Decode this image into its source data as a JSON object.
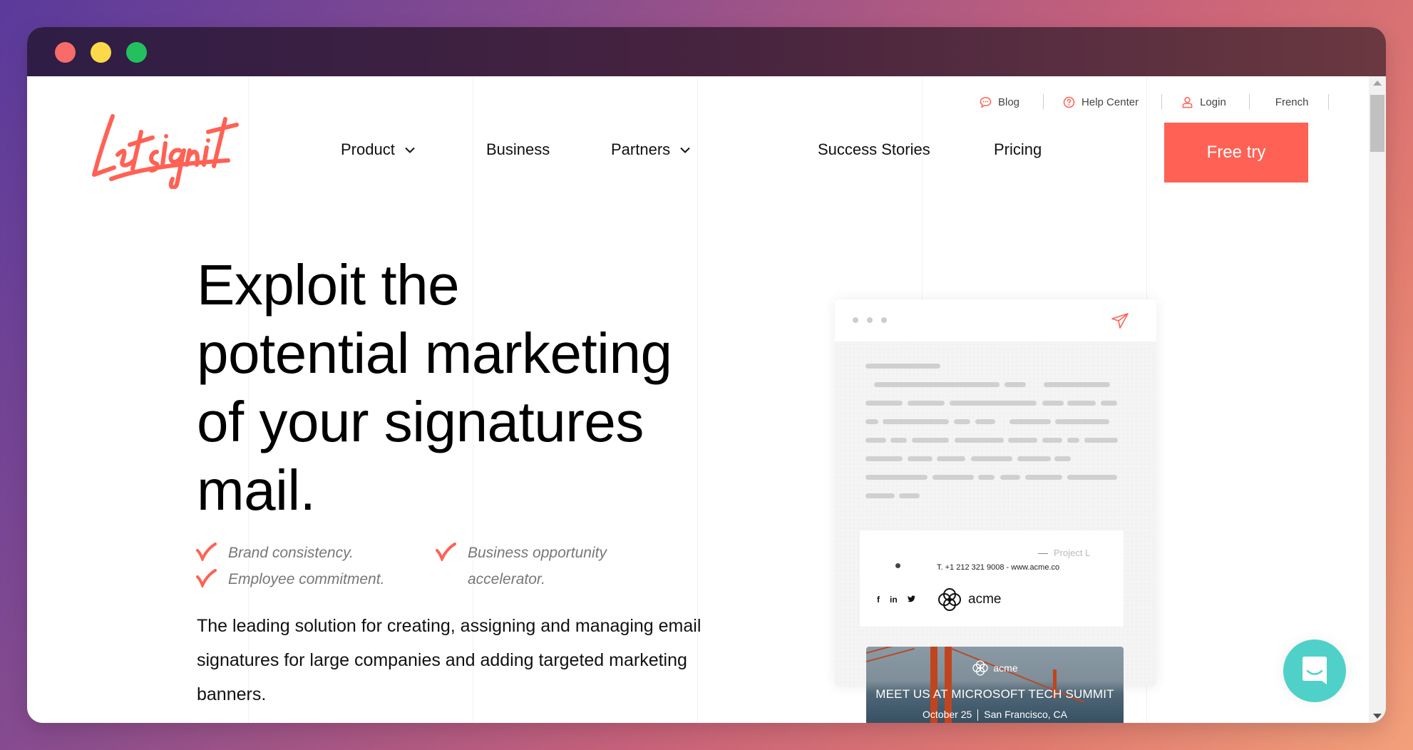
{
  "window": {
    "controls": [
      "close",
      "minimize",
      "maximize"
    ]
  },
  "brand": {
    "logo_text": "Letsignit",
    "accent_color": "#ff6154",
    "chat_color": "#4fd1c9"
  },
  "utility_nav": {
    "blog": "Blog",
    "help_center": "Help Center",
    "login": "Login",
    "language": "French"
  },
  "main_nav": {
    "product": "Product",
    "business": "Business",
    "partners": "Partners",
    "success_stories": "Success Stories",
    "pricing": "Pricing",
    "cta": "Free try"
  },
  "hero": {
    "title_lines": [
      "Exploit the",
      "potential marketing",
      "of your signatures",
      "mail."
    ],
    "benefits": [
      "Brand consistency.",
      "Employee commitment.",
      "Business opportunity accelerator."
    ],
    "description": "The leading solution for creating, assigning and managing email signatures for large companies and adding targeted marketing banners."
  },
  "mail_preview": {
    "signature": {
      "title": "Project L",
      "contact": "T. +1 212 321 9008 - www.acme.co",
      "social": [
        "f",
        "in",
        "twitter"
      ],
      "company": "acme"
    },
    "banner": {
      "brand": "acme",
      "title": "MEET US AT MICROSOFT TECH SUMMIT",
      "date": "October 25",
      "location": "San Francisco, CA"
    }
  },
  "chat": {
    "label": "Open chat"
  }
}
